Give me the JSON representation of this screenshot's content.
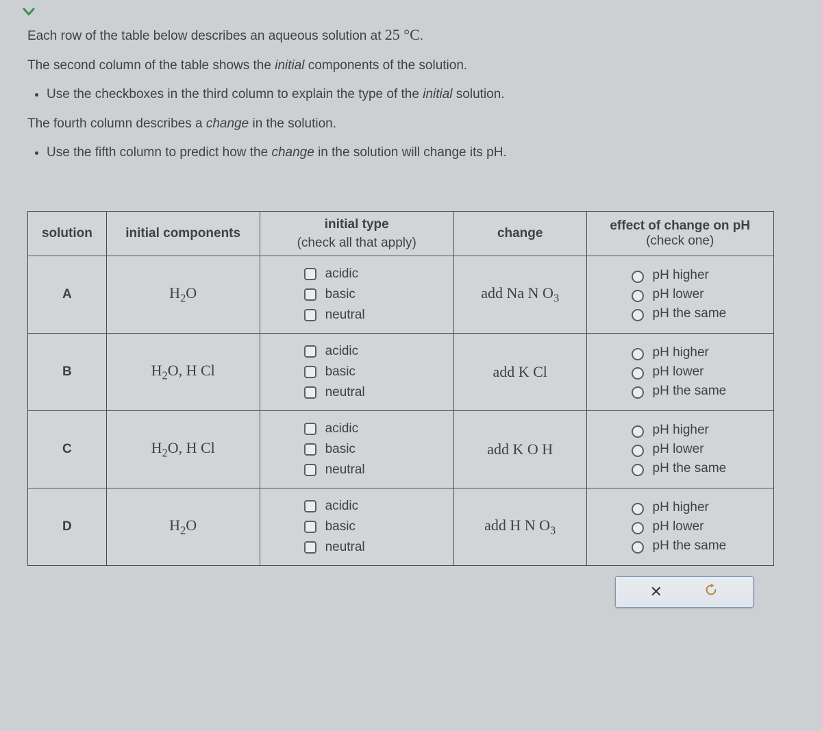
{
  "intro": {
    "p1_a": "Each row of the table below describes an aqueous solution at ",
    "p1_temp": "25 °C",
    "p1_b": ".",
    "p2_a": "The second column of the table shows the ",
    "p2_i": "initial",
    "p2_b": " components of the solution.",
    "li1_a": "Use the checkboxes in the third column to explain the type of the ",
    "li1_i": "initial",
    "li1_b": " solution.",
    "p3_a": "The fourth column describes a ",
    "p3_i": "change",
    "p3_b": " in the solution.",
    "li2_a": "Use the fifth column to predict how the ",
    "li2_i": "change",
    "li2_b": " in the solution will change its pH."
  },
  "headers": {
    "c1": "solution",
    "c2": "initial components",
    "c3_a": "initial type",
    "c3_b": "(check all that apply)",
    "c4": "change",
    "c5_a": "effect of change on pH",
    "c5_b": "(check one)"
  },
  "type_labels": {
    "acidic": "acidic",
    "basic": "basic",
    "neutral": "neutral"
  },
  "effect_labels": {
    "higher": "pH higher",
    "lower": "pH lower",
    "same": "pH the same"
  },
  "rows": {
    "a": {
      "id": "A",
      "components_html": "H<sub class='sub'>2</sub>O",
      "change_html": "add  Na N O<sub class='sub'>3</sub>"
    },
    "b": {
      "id": "B",
      "components_html": "H<sub class='sub'>2</sub>O, H Cl",
      "change_html": "add  K Cl"
    },
    "c": {
      "id": "C",
      "components_html": "H<sub class='sub'>2</sub>O, H Cl",
      "change_html": "add  K O H"
    },
    "d": {
      "id": "D",
      "components_html": "H<sub class='sub'>2</sub>O",
      "change_html": "add  H N O<sub class='sub'>3</sub>"
    }
  }
}
